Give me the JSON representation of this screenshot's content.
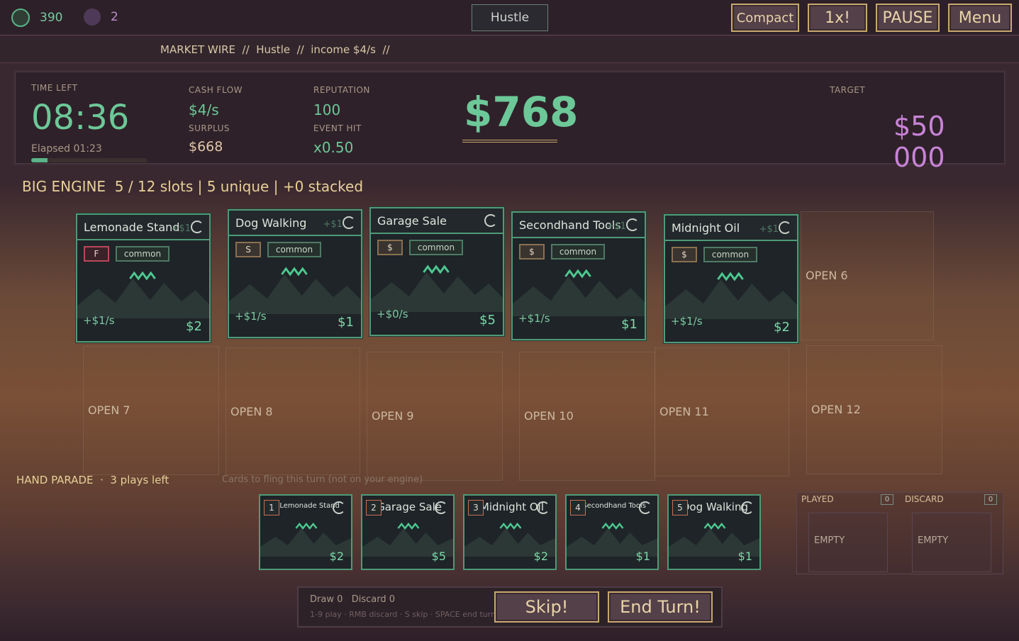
{
  "resources": {
    "coins": "390",
    "gems": "2"
  },
  "mode": "Hustle",
  "top_buttons": {
    "compact": "Compact",
    "speed": "1x!",
    "pause": "PAUSE",
    "menu": "Menu"
  },
  "ticker": "MARKET WIRE  //  Hustle  //  income $4/s  //",
  "stats": {
    "time_left_label": "TIME LEFT",
    "time_left": "08:36",
    "elapsed": "Elapsed 01:23",
    "elapsed_progress": 0.14,
    "cash_flow_label": "CASH FLOW",
    "cash_flow": "$4/s",
    "surplus_label": "SURPLUS",
    "surplus": "$668",
    "reputation_label": "REPUTATION",
    "reputation": "100",
    "event_hit_label": "EVENT HIT",
    "event_hit": "x0.50",
    "money": "$768",
    "target_label": "TARGET",
    "target": "$50 000"
  },
  "engine": {
    "title": "BIG ENGINE  5 / 12 slots | 5 unique | +0 stacked",
    "cards": [
      {
        "name": "Lemonade Stand",
        "ghost": "+$1",
        "tag": "F",
        "rarity": "common",
        "rate": "+$1/s",
        "cost": "$2"
      },
      {
        "name": "Dog Walking",
        "ghost": "+$1",
        "tag": "S",
        "rarity": "common",
        "rate": "+$1/s",
        "cost": "$1"
      },
      {
        "name": "Garage Sale",
        "ghost": "",
        "tag": "$",
        "rarity": "common",
        "rate": "+$0/s",
        "cost": "$5"
      },
      {
        "name": "Secondhand Tools",
        "ghost": "+$1",
        "tag": "$",
        "rarity": "common",
        "rate": "+$1/s",
        "cost": "$1"
      },
      {
        "name": "Midnight Oil",
        "ghost": "+$1",
        "tag": "$",
        "rarity": "common",
        "rate": "+$1/s",
        "cost": "$2"
      }
    ],
    "open_slots": [
      "OPEN 6",
      "OPEN 7",
      "OPEN 8",
      "OPEN 9",
      "OPEN 10",
      "OPEN 11",
      "OPEN 12"
    ]
  },
  "hand": {
    "title": "HAND PARADE  ·  3 plays left",
    "hint": "Cards to fling this turn (not on your engine)",
    "cards": [
      {
        "num": "1",
        "name": "Lemonade Stand",
        "cost": "$2"
      },
      {
        "num": "2",
        "name": "Garage Sale",
        "cost": "$5"
      },
      {
        "num": "3",
        "name": "Midnight Oil",
        "cost": "$2"
      },
      {
        "num": "4",
        "name": "Secondhand Tools",
        "cost": "$1"
      },
      {
        "num": "5",
        "name": "Dog Walking",
        "cost": "$1"
      }
    ]
  },
  "piles": {
    "played_label": "PLAYED",
    "played_count": "0",
    "played_empty": "EMPTY",
    "discard_label": "DISCARD",
    "discard_count": "0",
    "discard_empty": "EMPTY"
  },
  "actions": {
    "counts": "Draw 0   Discard 0",
    "keys": "1-9 play  ·  RMB discard  ·  S skip  ·  SPACE end turn",
    "skip": "Skip!",
    "end_turn": "End Turn!"
  },
  "colors": {
    "accent_green": "#6cc898",
    "target_purple": "#c884d8",
    "gold_border": "#c8a870",
    "tag_red": "#b84858"
  }
}
